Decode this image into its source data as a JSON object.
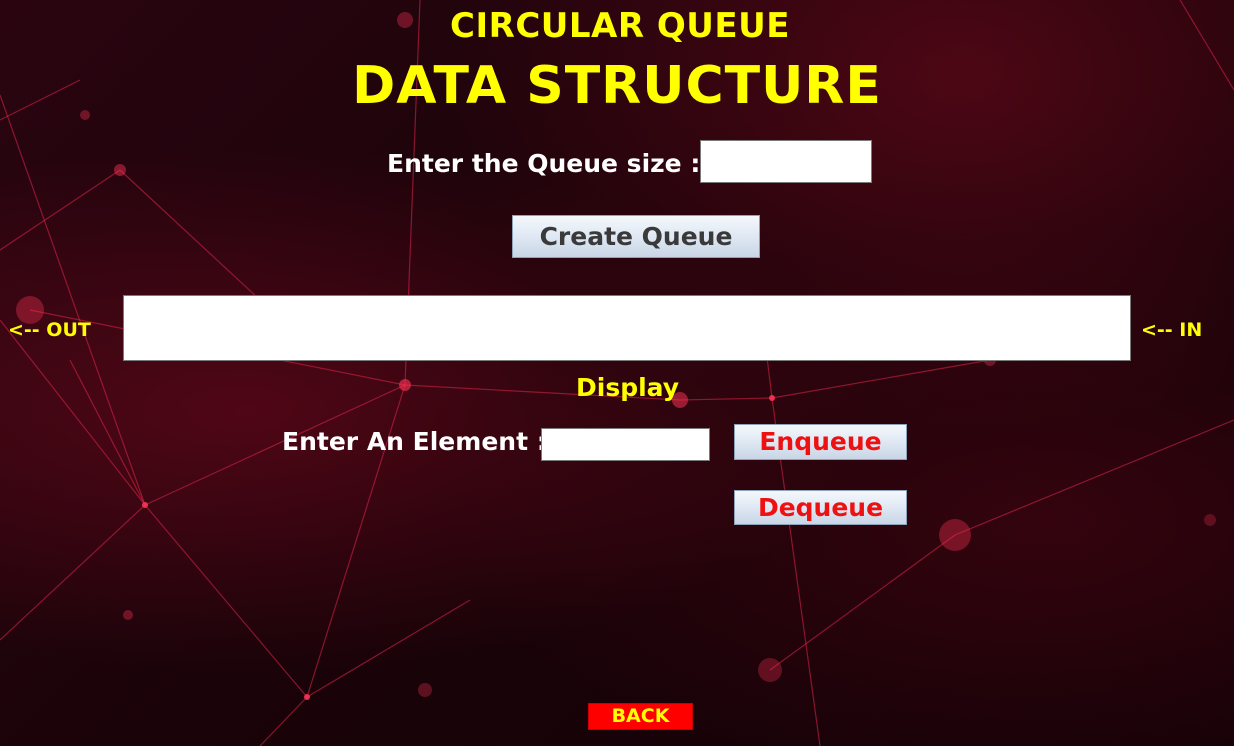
{
  "header": {
    "title": "CIRCULAR QUEUE",
    "subtitle": "DATA STRUCTURE"
  },
  "queue_size": {
    "label": "Enter the Queue size  :",
    "value": ""
  },
  "create_button": {
    "label": "Create Queue"
  },
  "queue_display": {
    "out_label": "<--  OUT",
    "in_label": "<--  IN",
    "caption": "Display",
    "value": ""
  },
  "element_entry": {
    "label": "Enter An Element :",
    "value": ""
  },
  "enqueue_button": {
    "label": "Enqueue"
  },
  "dequeue_button": {
    "label": "Dequeue"
  },
  "back_button": {
    "label": "BACK"
  },
  "colors": {
    "title": "#ffff00",
    "label": "#ffffff",
    "action_text": "#ee1111",
    "back_bg": "#ff0000",
    "background": "#1a0309"
  }
}
